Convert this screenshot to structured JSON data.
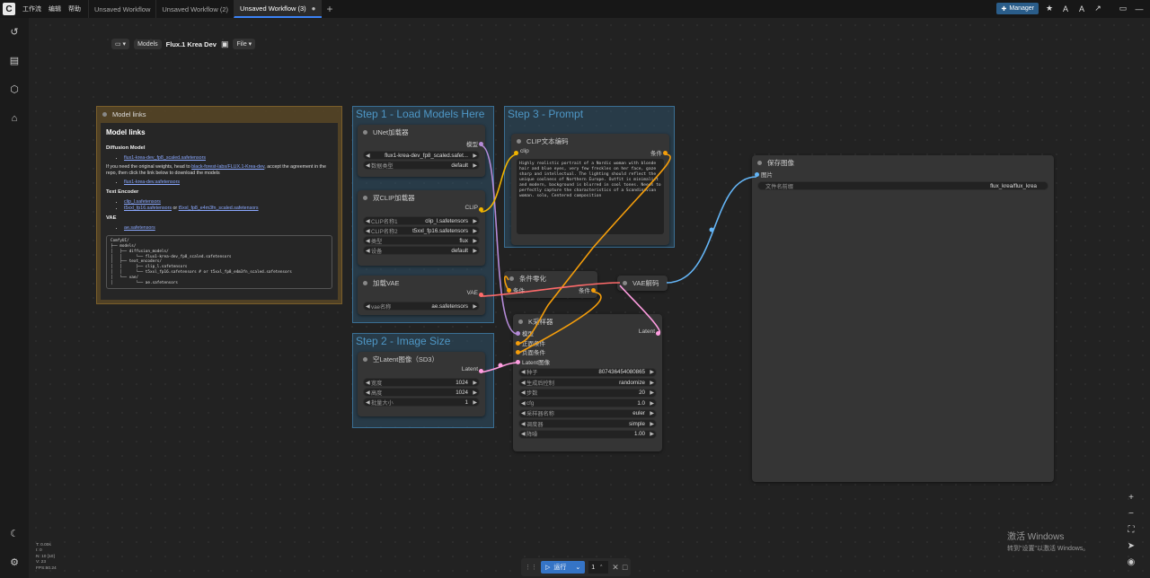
{
  "topbar": {
    "logo": "C",
    "menus": [
      "工作流",
      "编辑",
      "帮助"
    ],
    "tabs": [
      {
        "label": "Unsaved Workflow",
        "active": false
      },
      {
        "label": "Unsaved Workflow (2)",
        "active": false
      },
      {
        "label": "Unsaved Workflow (3)",
        "active": true
      }
    ],
    "manager_label": "Manager"
  },
  "breadcrumb": {
    "models": "Models",
    "title": "Flux.1 Krea Dev",
    "file": "File"
  },
  "groups": {
    "model_links": "Model links",
    "step1": "Step 1 - Load Models Here",
    "step2": "Step 2 - Image Size",
    "step3": "Step 3 - Prompt"
  },
  "markdown": {
    "h1": "Model links",
    "diffusion_heading": "Diffusion Model",
    "diffusion_link": "flux1-krea-dev_fp8_scaled.safetensors",
    "note_pre": "If you need the original weights, head to ",
    "note_link": "black-forest-labs/FLUX.1-Krea-dev",
    "note_post": ", accept the agreement in the repo, then click the link below to download the models",
    "orig_link": "flux1-krea-dev.safetensors",
    "text_encoder_heading": "Text Encoder",
    "te_link1": "clip_l.safetensors",
    "te_link2": "t5xxl_fp16.safetensors",
    "te_or": " or ",
    "te_link3": "t5xxl_fp8_e4m3fn_scaled.safetensors",
    "vae_heading": "VAE",
    "vae_link": "ae.safetensors",
    "tree": "ComfyUI/\n├── models/\n│   ├── diffusion_models/\n│   │      └── flux1-krea-dev_fp8_scaled.safetensors\n│   ├── text_encoders/\n│   │      ├── clip_l.safetensors\n│   │      └── t5xxl_fp16.safetensors # or t5xxl_fp8_e4m3fn_scaled.safetensors\n│   └── vae/\n│          └── ae.safetensors"
  },
  "nodes": {
    "unet": {
      "title": "UNet加载器",
      "out": "模型",
      "w1_label": "",
      "w1_value": "flux1-krea-dev_fp8_scaled.safet...",
      "w2_label": "数据类型",
      "w2_value": "default"
    },
    "dualclip": {
      "title": "双CLIP加载器",
      "out": "CLIP",
      "w1_label": "CLIP名称1",
      "w1_value": "clip_l.safetensors",
      "w2_label": "CLIP名称2",
      "w2_value": "t5xxl_fp16.safetensors",
      "w3_label": "类型",
      "w3_value": "flux",
      "w4_label": "设备",
      "w4_value": "default"
    },
    "vae_loader": {
      "title": "加载VAE",
      "out": "VAE",
      "w1_label": "vae名称",
      "w1_value": "ae.safetensors"
    },
    "latent": {
      "title": "空Latent图像（SD3）",
      "out": "Latent",
      "w1_label": "宽度",
      "w1_value": "1024",
      "w2_label": "高度",
      "w2_value": "1024",
      "w3_label": "批量大小",
      "w3_value": "1"
    },
    "clip_text": {
      "title": "CLIP文本编码",
      "in": "clip",
      "out": "条件",
      "prompt": "Highly realistic portrait of a Nordic woman with blonde hair and blue eyes, very few freckles on her face, gaze sharp and intellectual. The lighting should reflect the unique coolness of Northern Europe. Outfit is minimalist and modern, background is blurred in cool tones. Needs to perfectly capture the characteristics of a Scandinavian woman. solo, Centered composition"
    },
    "zero_out": {
      "title": "条件零化",
      "in": "条件",
      "out": "条件"
    },
    "vae_decode": {
      "title": "VAE解码"
    },
    "ksampler": {
      "title": "K采样器",
      "in1": "模型",
      "in2": "正面条件",
      "in3": "负面条件",
      "in4": "Latent图像",
      "out": "Latent",
      "widgets": [
        {
          "label": "种子",
          "value": "807436454080865"
        },
        {
          "label": "生成后控制",
          "value": "randomize"
        },
        {
          "label": "步数",
          "value": "20"
        },
        {
          "label": "cfg",
          "value": "1.0"
        },
        {
          "label": "采样器名称",
          "value": "euler"
        },
        {
          "label": "调度器",
          "value": "simple"
        },
        {
          "label": "降噪",
          "value": "1.00"
        }
      ]
    },
    "save": {
      "title": "保存图像",
      "in": "图片",
      "w1_label": "文件名前缀",
      "w1_value": "flux_krea/flux_krea"
    }
  },
  "stats": [
    "T: 0.00s",
    "I: 0",
    "N: 10 [10]",
    "V: 23",
    "FPS:60.24"
  ],
  "runbar": {
    "run_label": "运行",
    "batch": "1"
  },
  "activate": {
    "line1": "激活 Windows",
    "line2": "转到\"设置\"以激活 Windows。"
  },
  "colors": {
    "accent": "#3b82f6",
    "model_link": "#b58bd8",
    "clip_link": "#f0b400",
    "cond_link": "#f59e0b",
    "vae_link": "#ff6b6b",
    "latent_link": "#ff9de1",
    "image_link": "#64b5f6"
  }
}
